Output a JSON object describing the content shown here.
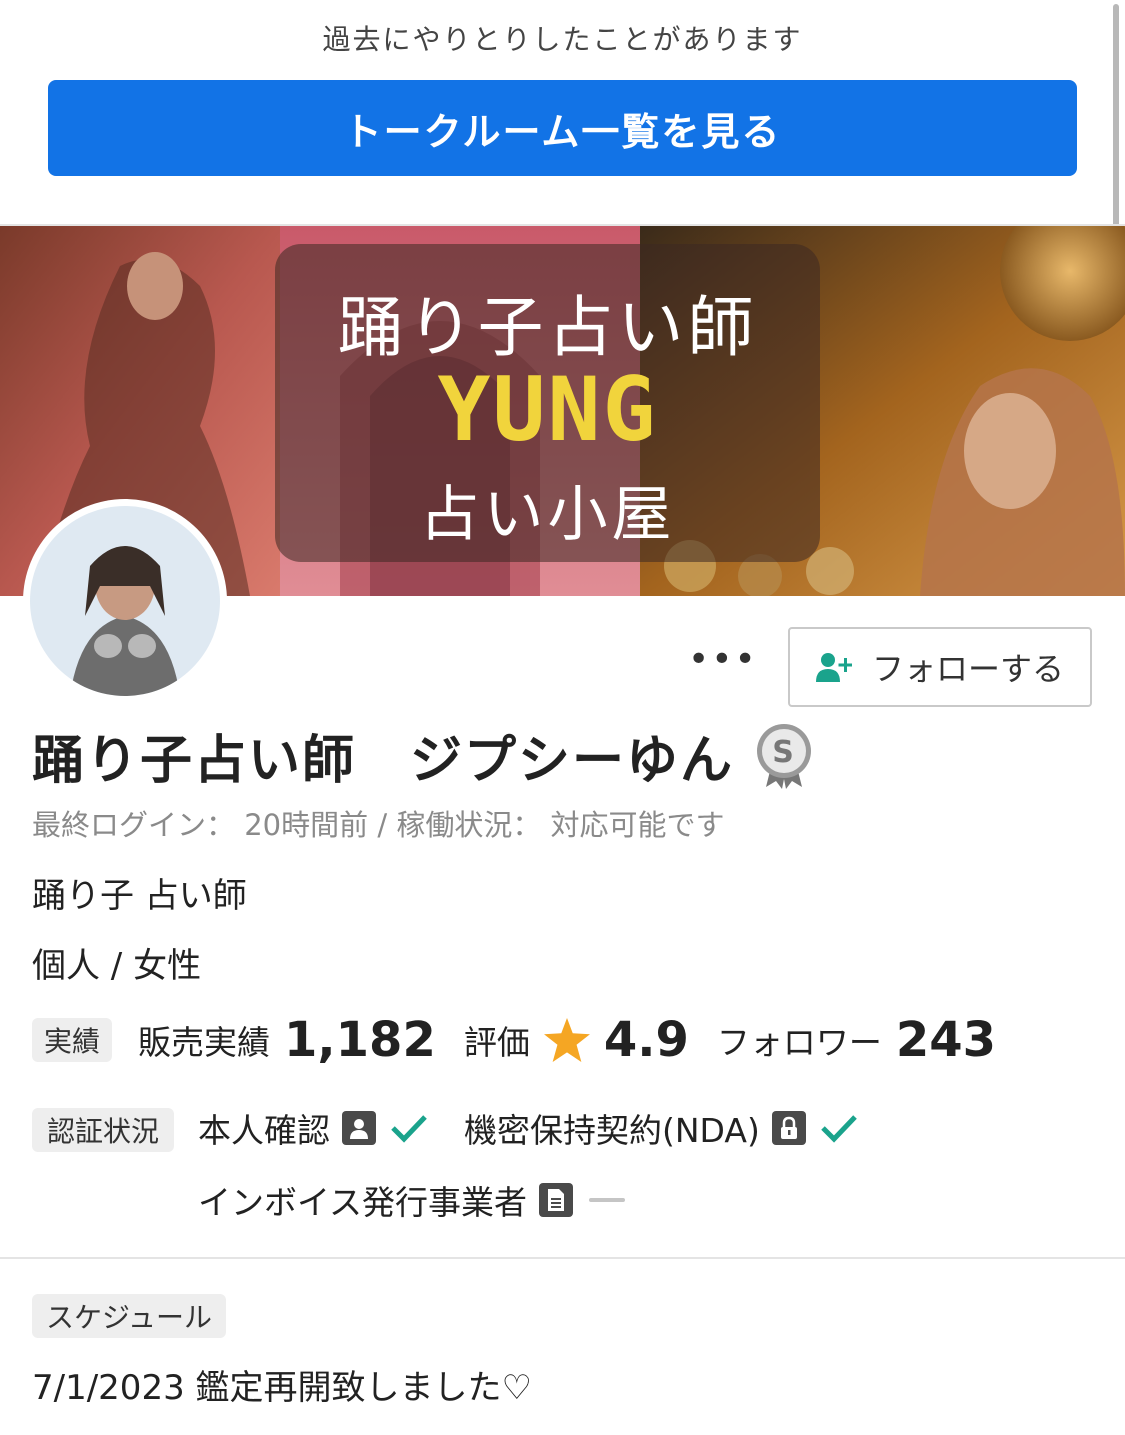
{
  "header": {
    "notice": "過去にやりとりしたことがあります",
    "talk_button": "トークルーム一覧を見る"
  },
  "banner": {
    "line1": "踊り子占い師",
    "line2": "YUNG",
    "line3": "占い小屋"
  },
  "profile": {
    "more_label": "•••",
    "follow_button": "フォローする",
    "name": "踊り子占い師　ジプシーゆん",
    "rank_badge": "S",
    "last_login": "最終ログイン： 20時間前 / 稼働状況： 対応可能です",
    "catchphrase": "踊り子 占い師",
    "type": "個人 / 女性"
  },
  "stats": {
    "tag": "実績",
    "sales_label": "販売実績",
    "sales_value": "1,182",
    "rating_label": "評価",
    "rating_value": "4.9",
    "followers_label": "フォロワー",
    "followers_value": "243"
  },
  "verification": {
    "tag": "認証状況",
    "identity": "本人確認",
    "nda": "機密保持契約(NDA)",
    "invoice": "インボイス発行事業者"
  },
  "schedule": {
    "tag": "スケジュール",
    "text": "7/1/2023 鑑定再開致しました♡"
  },
  "colors": {
    "primary": "#1273e6",
    "check_green": "#1aa38c",
    "star": "#f5a623"
  }
}
